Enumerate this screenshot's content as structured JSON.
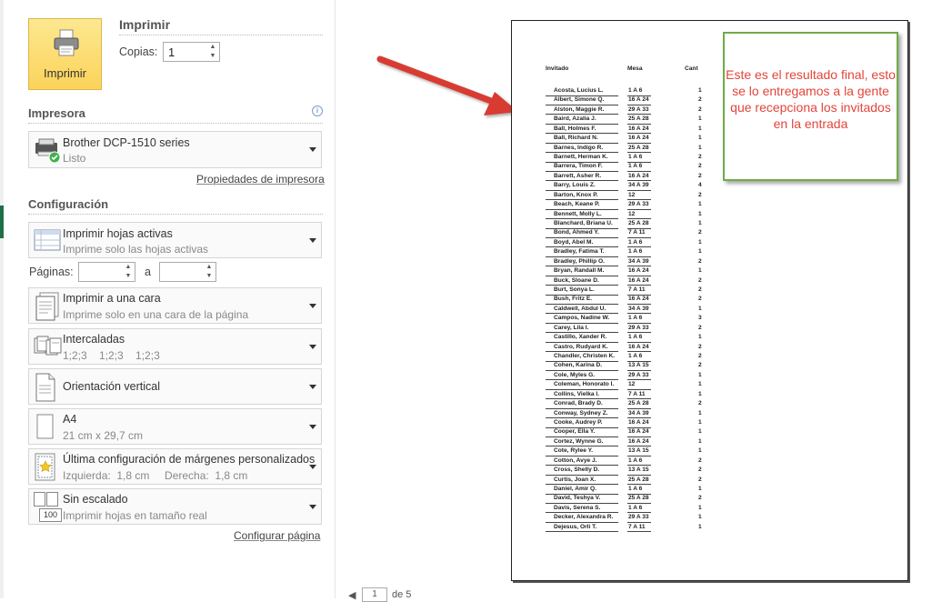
{
  "print_section": {
    "title": "Imprimir",
    "big_button_label": "Imprimir",
    "copies_label": "Copias:",
    "copies_value": "1"
  },
  "printer": {
    "heading": "Impresora",
    "name": "Brother DCP-1510 series",
    "status": "Listo",
    "properties_link": "Propiedades de impresora"
  },
  "settings": {
    "heading": "Configuración",
    "sheets": {
      "title": "Imprimir hojas activas",
      "subtitle": "Imprime solo las hojas activas"
    },
    "pages_label": "Páginas:",
    "pages_to": "a",
    "sides": {
      "title": "Imprimir a una cara",
      "subtitle": "Imprime solo en una cara de la página"
    },
    "collate": {
      "title": "Intercaladas",
      "subtitle": "1;2;3    1;2;3    1;2;3"
    },
    "orientation": {
      "title": "Orientación vertical"
    },
    "paper": {
      "title": "A4",
      "subtitle": "21 cm x 29,7 cm"
    },
    "margins": {
      "title": "Última configuración de márgenes personalizados",
      "subtitle": "Izquierda:  1,8 cm     Derecha:  1,8 cm"
    },
    "scaling": {
      "title": "Sin escalado",
      "subtitle": "Imprimir hojas en tamaño real",
      "icon_text": "100"
    },
    "page_setup_link": "Configurar página"
  },
  "preview": {
    "columns": [
      "Invitado",
      "Mesa",
      "Cant"
    ],
    "rows": [
      [
        "Acosta, Lucius L.",
        "1 A 6",
        "1"
      ],
      [
        "Albert, Simone Q.",
        "16 A 24",
        "2"
      ],
      [
        "Alston, Maggie R.",
        "29 A 33",
        "2"
      ],
      [
        "Baird, Azalia J.",
        "25 A 28",
        "1"
      ],
      [
        "Ball, Holmes F.",
        "16 A 24",
        "1"
      ],
      [
        "Ball, Richard N.",
        "16 A 24",
        "1"
      ],
      [
        "Barnes, Indigo R.",
        "25 A 28",
        "1"
      ],
      [
        "Barnett, Herman K.",
        "1 A 6",
        "2"
      ],
      [
        "Barrera, Timon F.",
        "1 A 6",
        "2"
      ],
      [
        "Barrett, Asher R.",
        "16 A 24",
        "2"
      ],
      [
        "Barry, Louis Z.",
        "34 A 39",
        "4"
      ],
      [
        "Barton, Knox P.",
        "12",
        "2"
      ],
      [
        "Beach, Keane P.",
        "29 A 33",
        "1"
      ],
      [
        "Bennett, Molly L.",
        "12",
        "1"
      ],
      [
        "Blanchard, Briana U.",
        "25 A 28",
        "1"
      ],
      [
        "Bond, Ahmed Y.",
        "7 A 11",
        "2"
      ],
      [
        "Boyd, Abel M.",
        "1 A 6",
        "1"
      ],
      [
        "Bradley, Fatima T.",
        "1 A 6",
        "1"
      ],
      [
        "Bradley, Phillip O.",
        "34 A 39",
        "2"
      ],
      [
        "Bryan, Randall M.",
        "16 A 24",
        "1"
      ],
      [
        "Buck, Sloane D.",
        "16 A 24",
        "2"
      ],
      [
        "Burt, Sonya L.",
        "7 A 11",
        "2"
      ],
      [
        "Bush, Fritz E.",
        "16 A 24",
        "2"
      ],
      [
        "Caldwell, Abdul U.",
        "34 A 39",
        "1"
      ],
      [
        "Campos, Nadine W.",
        "1 A 6",
        "3"
      ],
      [
        "Carey, Lila I.",
        "29 A 33",
        "2"
      ],
      [
        "Castillo, Xander R.",
        "1 A 6",
        "1"
      ],
      [
        "Castro, Rudyard K.",
        "16 A 24",
        "2"
      ],
      [
        "Chandler, Christen K.",
        "1 A 6",
        "2"
      ],
      [
        "Cohen, Karina D.",
        "13 A 15",
        "2"
      ],
      [
        "Cole, Myles G.",
        "29 A 33",
        "1"
      ],
      [
        "Coleman, Honorato I.",
        "12",
        "1"
      ],
      [
        "Collins, Vielka I.",
        "7 A 11",
        "1"
      ],
      [
        "Conrad, Brady D.",
        "25 A 28",
        "2"
      ],
      [
        "Conway, Sydney Z.",
        "34 A 39",
        "1"
      ],
      [
        "Cooke, Audrey P.",
        "16 A 24",
        "1"
      ],
      [
        "Cooper, Ella Y.",
        "16 A 24",
        "1"
      ],
      [
        "Cortez, Wynne G.",
        "16 A 24",
        "1"
      ],
      [
        "Cote, Rylee Y.",
        "13 A 15",
        "1"
      ],
      [
        "Cotton, Avye J.",
        "1 A 6",
        "2"
      ],
      [
        "Cross, Shelly D.",
        "13 A 15",
        "2"
      ],
      [
        "Curtis, Joan X.",
        "25 A 28",
        "2"
      ],
      [
        "Daniel, Amir Q.",
        "1 A 6",
        "1"
      ],
      [
        "David, Teshya V.",
        "25 A 28",
        "2"
      ],
      [
        "Davis, Serena S.",
        "1 A 6",
        "1"
      ],
      [
        "Decker, Alexandra R.",
        "29 A 33",
        "1"
      ],
      [
        "Dejesus, Orli T.",
        "7 A 11",
        "1"
      ]
    ],
    "callout_text": "Este es el resultado final, esto se lo entregamos a la gente que recepciona los invitados en la entrada",
    "page_current": "1",
    "page_total": "de 5"
  }
}
